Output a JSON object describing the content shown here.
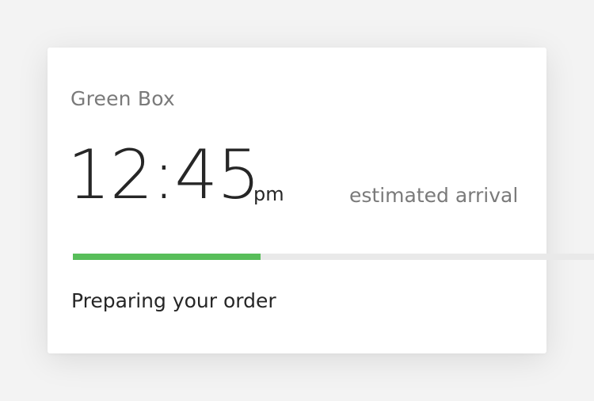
{
  "order": {
    "restaurant_name": "Green Box",
    "time": "12:45",
    "time_suffix": "pm",
    "eta_label": "estimated arrival",
    "status": "Preparing your order",
    "progress_fraction": 0.36
  },
  "colors": {
    "progress_fill": "#58be5a",
    "progress_track": "#e9e9e9",
    "primary_text": "#262626",
    "secondary_text": "#7a7a7a"
  }
}
